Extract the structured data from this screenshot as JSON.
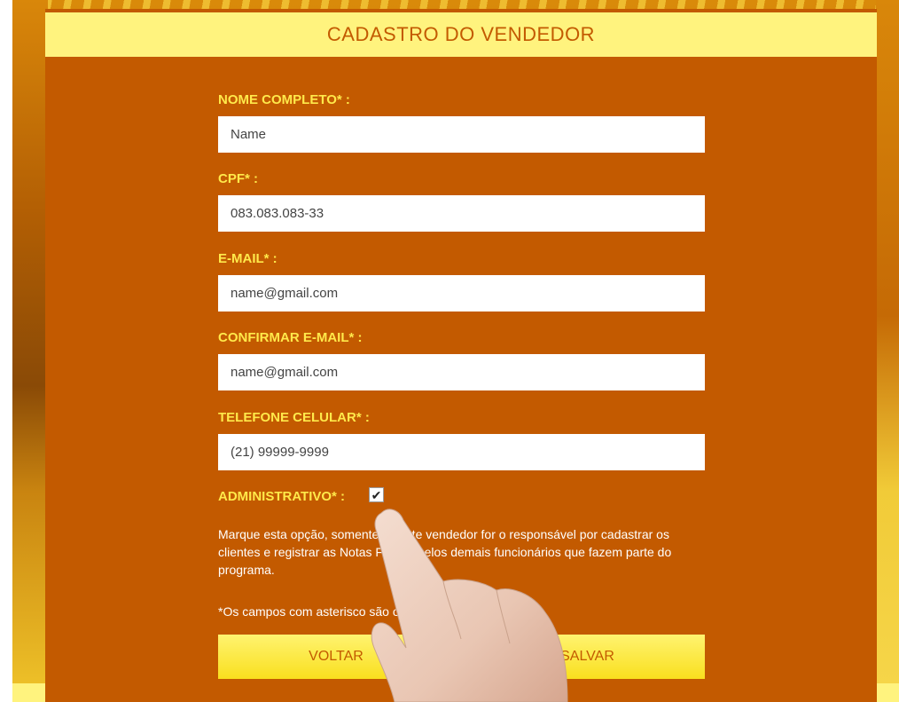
{
  "header": {
    "title": "CADASTRO DO VENDEDOR"
  },
  "form": {
    "name_label": "NOME COMPLETO* :",
    "name_value": "Name",
    "cpf_label": "CPF* :",
    "cpf_value": "083.083.083-33",
    "email_label": "E-MAIL* :",
    "email_value": "name@gmail.com",
    "confirm_email_label": "CONFIRMAR E-MAIL* :",
    "confirm_email_value": "name@gmail.com",
    "phone_label": "TELEFONE CELULAR* :",
    "phone_value": "(21) 99999-9999",
    "admin_label": "ADMINISTRATIVO* :",
    "admin_checked": true,
    "admin_check_glyph": "✔",
    "note": "Marque esta opção, somente se este vendedor for o responsável por cadastrar os clientes e registrar as Notas Fiscais pelos demais funcionários que fazem parte do programa.",
    "required_note": "*Os campos com asterisco são obrigatórios."
  },
  "buttons": {
    "back_label": "VOLTAR",
    "save_label": "SALVAR"
  },
  "colors": {
    "panel": "#c35a00",
    "header_bg": "#fff37e",
    "label_yellow": "#ffe94a",
    "button_yellow": "#f9df1e"
  },
  "icons": {
    "checkbox": "checkmark-icon",
    "pointer": "hand-pointer-icon"
  }
}
